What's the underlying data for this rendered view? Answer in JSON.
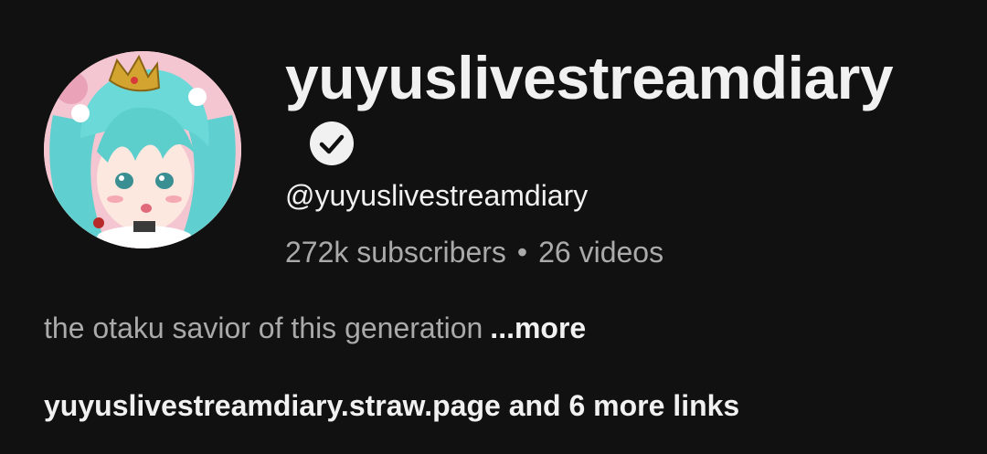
{
  "channel": {
    "name": "yuyuslivestreamdiary",
    "handle": "@yuyuslivestreamdiary",
    "subscribers": "272k subscribers",
    "separator": "•",
    "videos": "26 videos",
    "verified_icon": "verified-check-icon",
    "avatar_icon": "anime-character-avatar"
  },
  "description": {
    "text": "the otaku savior of this generation",
    "more_label": "...more"
  },
  "links": {
    "label": "yuyuslivestreamdiary.straw.page and 6 more links"
  },
  "colors": {
    "background": "#111111",
    "primary_text": "#f1f1f1",
    "secondary_text": "#aaaaaa"
  }
}
